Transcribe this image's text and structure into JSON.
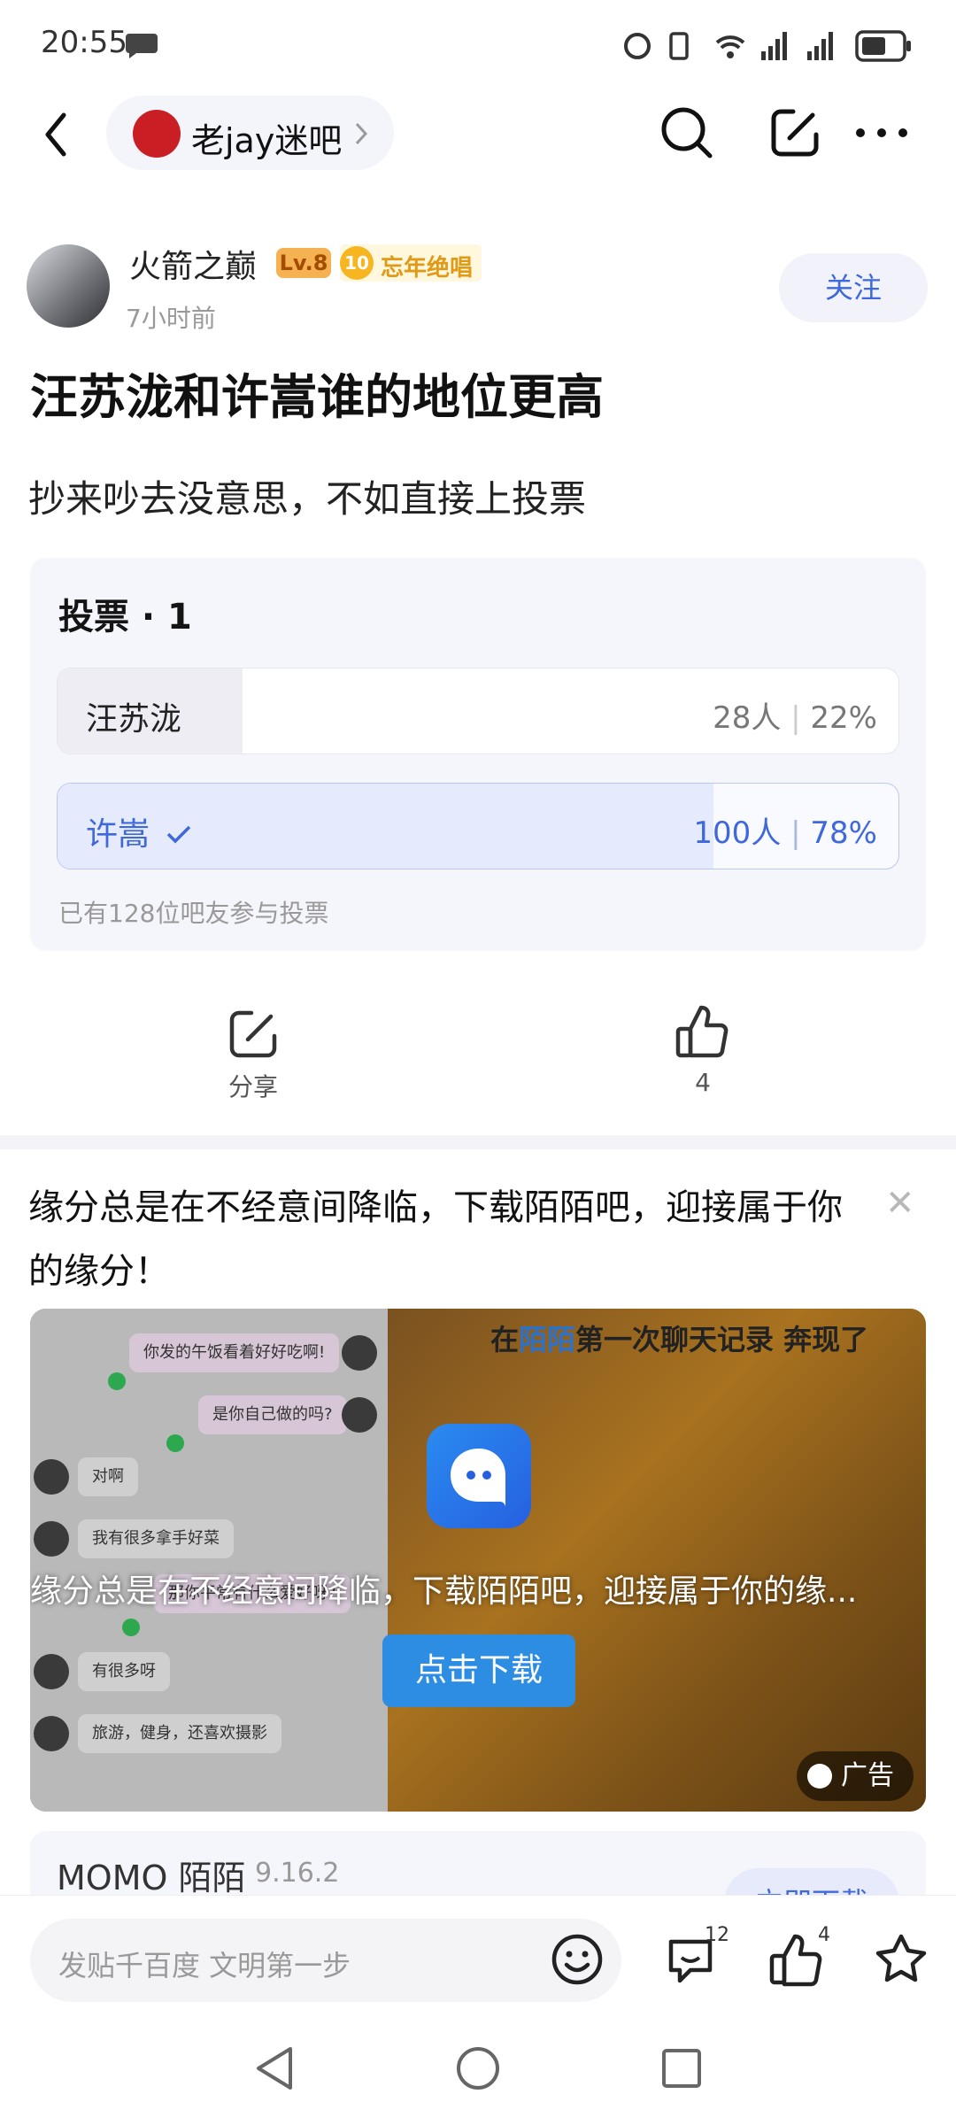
{
  "status": {
    "time": "20:55"
  },
  "nav": {
    "forum_name": "老jay迷吧"
  },
  "author": {
    "name": "火箭之巅",
    "level": "Lv.8",
    "medal_number": "10",
    "medal": "忘年绝唱",
    "time_ago": "7小时前",
    "follow": "关注"
  },
  "post": {
    "title": "汪苏泷和许嵩谁的地位更高",
    "body": "抄来吵去没意思，不如直接上投票"
  },
  "vote": {
    "header": "投票 · 1",
    "options": [
      {
        "label": "汪苏泷",
        "count": "28人",
        "percent": "22%",
        "selected": false,
        "fraction": 0.22
      },
      {
        "label": "许嵩",
        "count": "100人",
        "percent": "78%",
        "selected": true,
        "fraction": 0.78
      }
    ],
    "footer": "已有128位吧友参与投票"
  },
  "actions": {
    "share": "分享",
    "like_count": "4"
  },
  "ad": {
    "text": "缘分总是在不经意间降临，下载陌陌吧，迎接属于你的缘分！",
    "top_prefix": "在",
    "top_highlight": "陌陌",
    "top_suffix": "第一次聊天记录 奔现了",
    "caption": "缘分总是在不经意间降临，下载陌陌吧，迎接属于你的缘...",
    "download": "点击下载",
    "badge": "广告",
    "chat": [
      "你发的午饭看着好好吃啊!",
      "是你自己做的吗?",
      "对啊",
      "我有很多拿手好菜",
      "那你平常有什么爱好呀?",
      "有很多呀",
      "旅游，健身，还喜欢摄影"
    ],
    "app_name": "MOMO 陌陌",
    "app_version": "9.16.2",
    "app_button": "立即下载"
  },
  "bottom": {
    "input_placeholder": "发贴千百度 文明第一步",
    "comment_count": "12",
    "like_count": "4"
  },
  "colors": {
    "accent": "#3f68db",
    "download": "#2c8de3"
  }
}
